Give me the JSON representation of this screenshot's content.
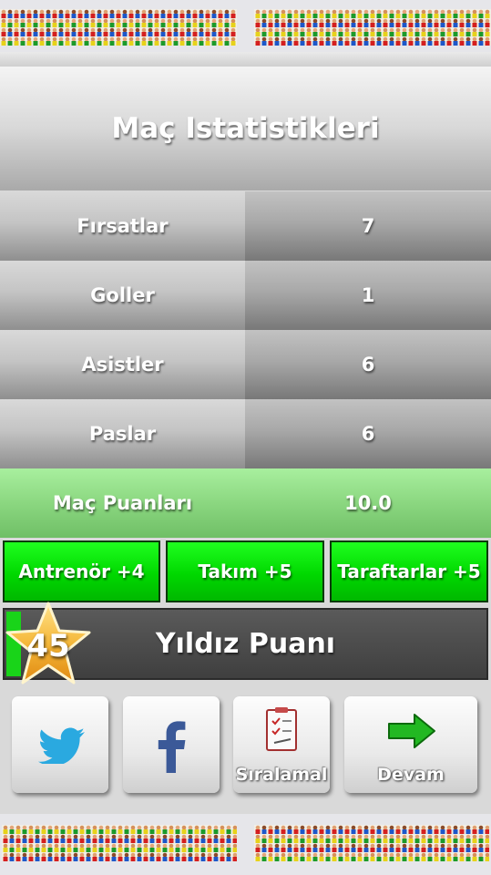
{
  "title": "Maç Istatistikleri",
  "stats": [
    {
      "label": "Fırsatlar",
      "value": "7"
    },
    {
      "label": "Goller",
      "value": "1"
    },
    {
      "label": "Asistler",
      "value": "6"
    },
    {
      "label": "Paslar",
      "value": "6"
    }
  ],
  "match_points": {
    "label": "Maç Puanları",
    "value": "10.0"
  },
  "bonuses": [
    {
      "label": "Antrenör +4"
    },
    {
      "label": "Takım +5"
    },
    {
      "label": "Taraftarlar +5"
    }
  ],
  "star_points": {
    "label": "Yıldız Puanı",
    "value": "45",
    "progress": 0.03
  },
  "buttons": {
    "twitter_icon": "twitter-bird-icon",
    "facebook_icon": "facebook-f-icon",
    "ranking_label": "Sıralamal",
    "continue_label": "Devam"
  },
  "colors": {
    "bonus_green": "#00d800",
    "points_green": "#8bd780",
    "twitter_blue": "#2aa9e0",
    "facebook_blue": "#3b5998",
    "arrow_green": "#22b822"
  }
}
